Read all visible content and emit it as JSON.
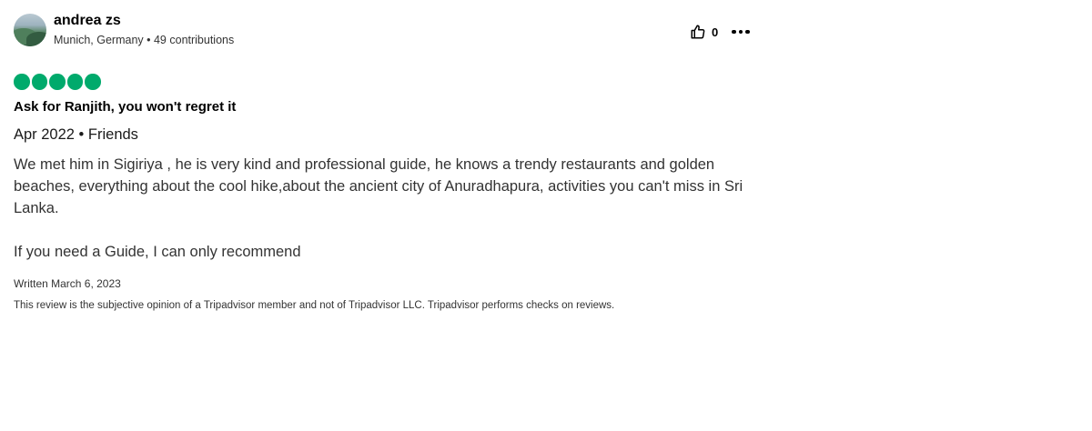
{
  "reviewer": {
    "name": "andrea zs",
    "location": "Munich, Germany",
    "separator": " • ",
    "contributions": "49 contributions"
  },
  "actions": {
    "like_icon": "thumbs-up-icon",
    "like_count": "0",
    "more_icon": "ellipsis-icon"
  },
  "rating": {
    "value": 5,
    "max": 5,
    "color": "#00aa6c"
  },
  "review": {
    "title": "Ask for Ranjith, you won't regret it",
    "trip_info": "Apr 2022 • Friends",
    "body_paragraph_1": "We met him in Sigiriya , he is very kind and professional guide, he knows a trendy restaurants and golden beaches, everything about the cool hike,about the ancient city of Anuradhapura, activities you can't miss in Sri Lanka.",
    "body_paragraph_2": "If you need a Guide, I can only recommend",
    "written_date": "Written March 6, 2023",
    "disclaimer": "This review is the subjective opinion of a Tripadvisor member and not of Tripadvisor LLC. Tripadvisor performs checks on reviews."
  }
}
